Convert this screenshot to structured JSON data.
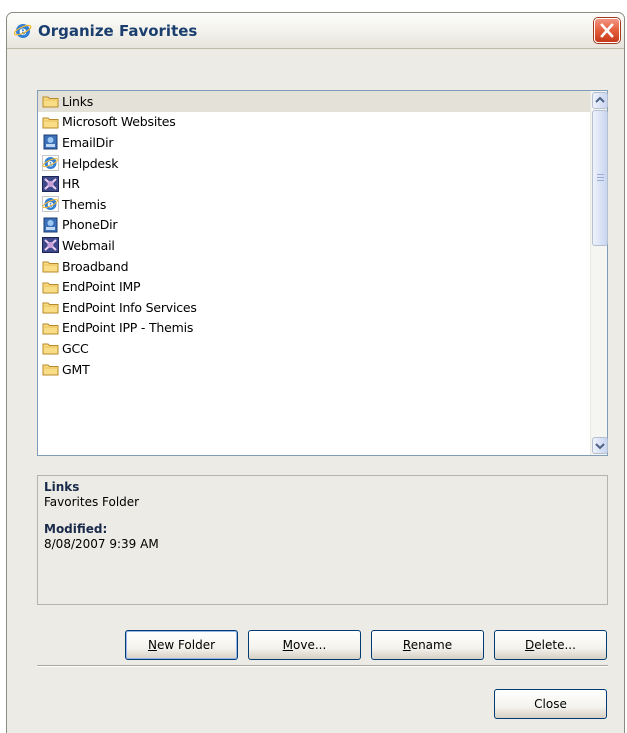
{
  "window": {
    "title": "Organize Favorites",
    "title_icon": "ie-icon",
    "close_icon": "close-icon"
  },
  "list": {
    "items": [
      {
        "label": "Links",
        "icon": "folder-icon",
        "selected": true
      },
      {
        "label": "Microsoft Websites",
        "icon": "folder-icon"
      },
      {
        "label": "EmailDir",
        "icon": "network-icon"
      },
      {
        "label": "Helpdesk",
        "icon": "ie-icon"
      },
      {
        "label": "HR",
        "icon": "web-icon"
      },
      {
        "label": "Themis",
        "icon": "ie-icon"
      },
      {
        "label": "PhoneDir",
        "icon": "network-icon"
      },
      {
        "label": "Webmail",
        "icon": "web-icon"
      },
      {
        "label": "Broadband",
        "icon": "folder-icon"
      },
      {
        "label": "EndPoint IMP",
        "icon": "folder-icon"
      },
      {
        "label": "EndPoint Info Services",
        "icon": "folder-icon"
      },
      {
        "label": "EndPoint IPP - Themis",
        "icon": "folder-icon"
      },
      {
        "label": "GCC",
        "icon": "folder-icon"
      },
      {
        "label": "GMT",
        "icon": "folder-icon"
      }
    ]
  },
  "details": {
    "name": "Links",
    "type": "Favorites Folder",
    "modified_label": "Modified:",
    "modified_value": "8/08/2007 9:39 AM"
  },
  "buttons": {
    "new_folder": {
      "mnemonic": "N",
      "rest": "ew Folder"
    },
    "move": {
      "mnemonic": "M",
      "rest": "ove..."
    },
    "rename": {
      "mnemonic": "R",
      "rest": "ename"
    },
    "delete": {
      "mnemonic": "D",
      "rest": "elete..."
    },
    "close": "Close"
  }
}
